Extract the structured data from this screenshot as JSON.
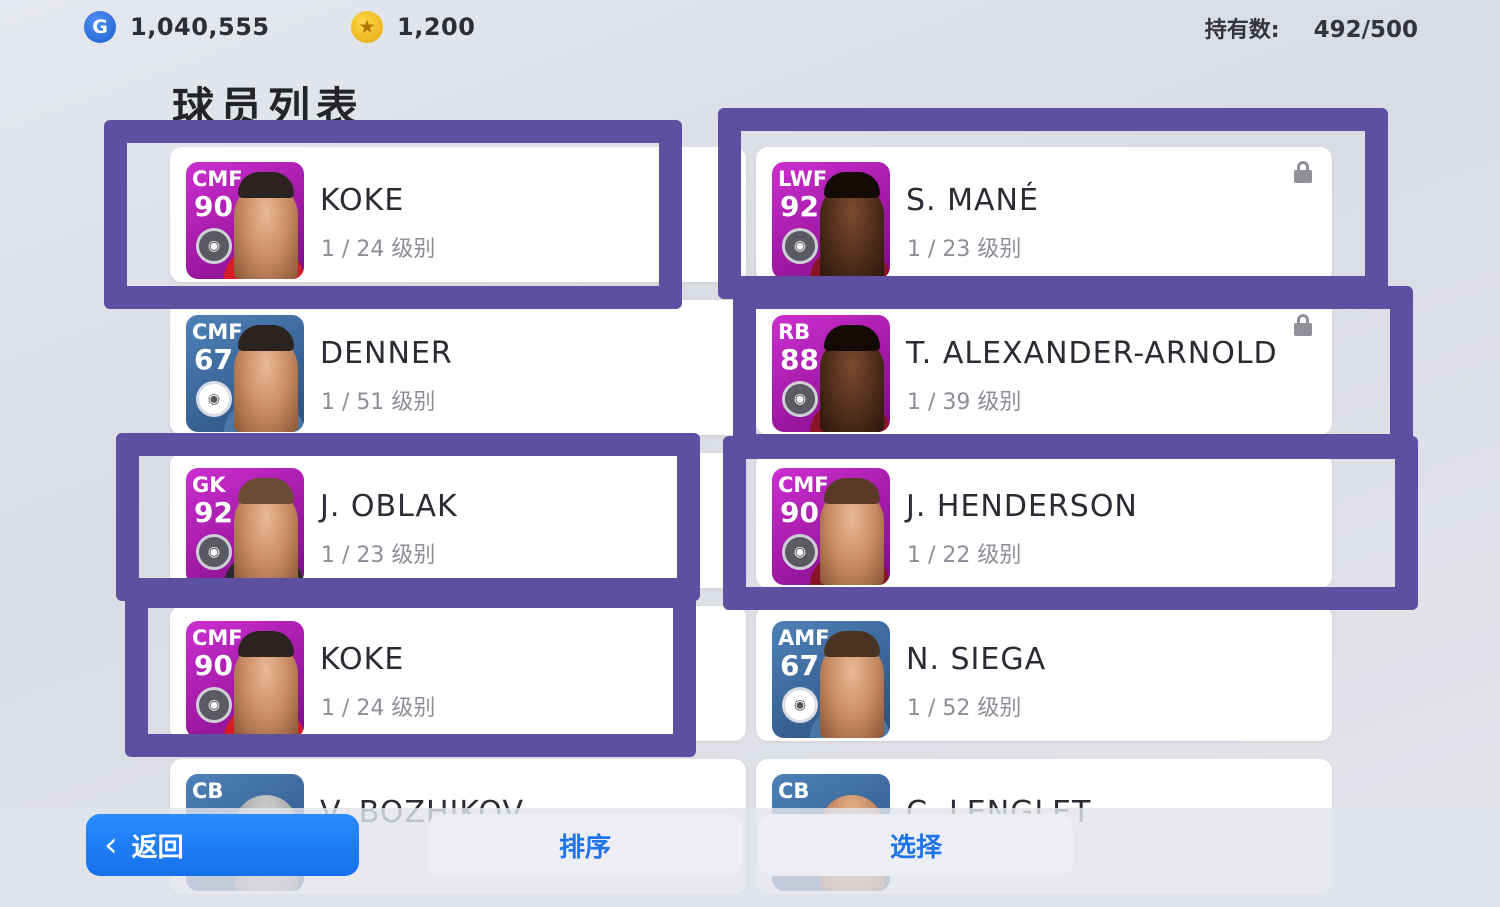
{
  "topbar": {
    "gp_icon": "G",
    "gp_value": "1,040,555",
    "coin_icon": "★",
    "coin_value": "1,200",
    "owned_label": "持有数:",
    "owned_value": "492/500"
  },
  "page": {
    "title": "球员列表"
  },
  "players": [
    {
      "position": "CMF",
      "rating": "90",
      "name": "KOKE",
      "level": "1 / 24 级别",
      "card": "purple",
      "locked": false
    },
    {
      "position": "LWF",
      "rating": "92",
      "name": "S. MANÉ",
      "level": "1 / 23 级别",
      "card": "purple",
      "locked": true
    },
    {
      "position": "CMF",
      "rating": "67",
      "name": "DENNER",
      "level": "1 / 51 级别",
      "card": "blue",
      "locked": false
    },
    {
      "position": "RB",
      "rating": "88",
      "name": "T. ALEXANDER-ARNOLD",
      "level": "1 / 39 级别",
      "card": "purple",
      "locked": true
    },
    {
      "position": "GK",
      "rating": "92",
      "name": "J. OBLAK",
      "level": "1 / 23 级别",
      "card": "purple",
      "locked": false
    },
    {
      "position": "CMF",
      "rating": "90",
      "name": "J. HENDERSON",
      "level": "1 / 22 级别",
      "card": "purple",
      "locked": false
    },
    {
      "position": "CMF",
      "rating": "90",
      "name": "KOKE",
      "level": "1 / 24 级别",
      "card": "purple",
      "locked": false
    },
    {
      "position": "AMF",
      "rating": "67",
      "name": "N. SIEGA",
      "level": "1 / 52 级别",
      "card": "blue",
      "locked": false
    },
    {
      "position": "CB",
      "rating": "",
      "name": "V. BOZHIKOV",
      "level": "",
      "card": "blue",
      "locked": false
    },
    {
      "position": "CB",
      "rating": "",
      "name": "C. LENGLET",
      "level": "",
      "card": "blue",
      "locked": false
    }
  ],
  "buttons": {
    "back_label": "返回",
    "sort_label": "排序",
    "select_label": "选择"
  },
  "colors": {
    "highlight_box": "#5f4fa0",
    "back_button": "#1f7ef0",
    "accent_text": "#1f74e8"
  },
  "icons": {
    "gp": "gp-currency-icon",
    "coin": "coin-icon",
    "lock": "lock-icon",
    "back": "chevron-left-icon"
  }
}
